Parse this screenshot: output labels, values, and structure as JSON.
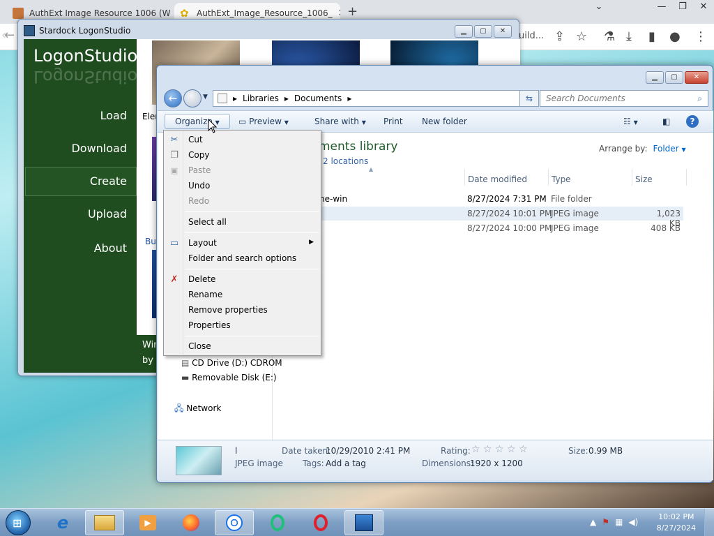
{
  "browser": {
    "tabs": [
      {
        "title": "AuthExt Image Resource 1006 (W",
        "close": "✕"
      },
      {
        "title": "AuthExt_Image_Resource_1006_",
        "close": "✕"
      }
    ],
    "new_tab": "+",
    "address_fragment": "uild..."
  },
  "logonstudio": {
    "title": "Stardock LogonStudio",
    "logo": "LogonStudio",
    "nav": [
      "Load",
      "Download",
      "Create",
      "Upload",
      "About"
    ],
    "content_fragments": [
      "Elen",
      "Buil"
    ],
    "footer": [
      "Win",
      "by"
    ]
  },
  "explorer": {
    "breadcrumb": [
      "Libraries",
      "Documents"
    ],
    "search_placeholder": "Search Documents",
    "toolbar": {
      "organize": "Organize",
      "preview": "Preview",
      "share_with": "Share with",
      "print": "Print",
      "new_folder": "New folder"
    },
    "library_title_fragment": "ments library",
    "library_sub_fragment": "2 locations",
    "arrange_by_label": "Arrange by:",
    "arrange_by_value": "Folder",
    "columns": [
      "Date modified",
      "Type",
      "Size"
    ],
    "rows": [
      {
        "name_fragment": "ne-win",
        "date": "8/27/2024 7:31 PM",
        "type": "File folder",
        "size": ""
      },
      {
        "name_fragment": "",
        "date": "8/27/2024 10:01 PM",
        "type": "JPEG image",
        "size": "1,023 KB"
      },
      {
        "name_fragment": "",
        "date": "8/27/2024 10:00 PM",
        "type": "JPEG image",
        "size": "408 KB"
      }
    ],
    "nav_pane": [
      {
        "label": "CD Drive (D:) CDROM",
        "icon": "cd-drive-icon"
      },
      {
        "label": "Removable Disk (E:)",
        "icon": "removable-disk-icon"
      },
      {
        "label": "Network",
        "icon": "network-icon"
      }
    ],
    "details": {
      "name": "l",
      "kind": "JPEG image",
      "date_taken_label": "Date taken:",
      "date_taken": "10/29/2010 2:41 PM",
      "tags_label": "Tags:",
      "tags": "Add a tag",
      "rating_label": "Rating:",
      "rating_stars": "☆ ☆ ☆ ☆ ☆",
      "dimensions_label": "Dimensions:",
      "dimensions": "1920 x 1200",
      "size_label": "Size:",
      "size": "0.99 MB"
    }
  },
  "organize_menu": {
    "items": [
      {
        "label": "Cut",
        "enabled": true,
        "icon": "cut-icon",
        "glyph": "✂"
      },
      {
        "label": "Copy",
        "enabled": true,
        "icon": "copy-icon",
        "glyph": "❐"
      },
      {
        "label": "Paste",
        "enabled": false,
        "icon": "paste-icon",
        "glyph": "📋"
      },
      {
        "label": "Undo",
        "enabled": true
      },
      {
        "label": "Redo",
        "enabled": false
      },
      {
        "label": "Select all",
        "enabled": true
      },
      {
        "label": "Layout",
        "enabled": true,
        "icon": "layout-icon",
        "glyph": "▭",
        "submenu": true
      },
      {
        "label": "Folder and search options",
        "enabled": true
      },
      {
        "label": "Delete",
        "enabled": true,
        "icon": "delete-icon",
        "glyph": "✗"
      },
      {
        "label": "Rename",
        "enabled": true
      },
      {
        "label": "Remove properties",
        "enabled": true
      },
      {
        "label": "Properties",
        "enabled": true
      },
      {
        "label": "Close",
        "enabled": true
      }
    ]
  },
  "taskbar": {
    "clock_time": "10:02 PM",
    "clock_date": "8/27/2024",
    "apps": [
      "ie-icon",
      "file-explorer-icon",
      "media-player-icon",
      "firefox-icon",
      "chrome-icon",
      "opera-gx-icon",
      "opera-icon",
      "logonstudio-icon"
    ]
  },
  "colors": {
    "logonstudio_green": "#1f4d1f",
    "explorer_chrome": "#d4e2f1",
    "menu_bg": "#f0f0f0",
    "taskbar": "#7e9fc4"
  }
}
